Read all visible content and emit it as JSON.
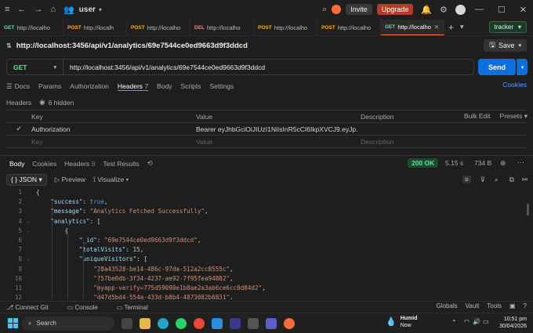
{
  "titlebar": {
    "workspace": "user",
    "invite": "Invite",
    "upgrade": "Upgrade"
  },
  "tabs": [
    {
      "method": "GET",
      "label": "http://localho"
    },
    {
      "method": "POST",
      "label": "http://localh"
    },
    {
      "method": "POST",
      "label": "http://localho"
    },
    {
      "method": "DEL",
      "label": "http://localho"
    },
    {
      "method": "POST",
      "label": "http://localho"
    },
    {
      "method": "POST",
      "label": "http://localho"
    },
    {
      "method": "GET",
      "label": "http://localho"
    }
  ],
  "environment": "tracker",
  "request": {
    "title": "http://localhost:3456/api/v1/analytics/69e7544ce0ed9663d9f3ddcd",
    "save": "Save",
    "method": "GET",
    "url": "http://localhost:3456/api/v1/analytics/69e7544ce0ed9663d9f3ddcd",
    "send": "Send",
    "tabs": [
      "Docs",
      "Params",
      "Authorization",
      "Headers",
      "Body",
      "Scripts",
      "Settings"
    ],
    "headers_count": "7",
    "cookies": "Cookies",
    "headers_label": "Headers",
    "hidden": "6 hidden"
  },
  "headers_table": {
    "columns": [
      "Key",
      "Value",
      "Description",
      "Bulk Edit",
      "Presets"
    ],
    "rows": [
      {
        "key": "Authorization",
        "value": "Bearer eyJhbGciOiJIUzI1NiIsInR5cCI6IkpXVCJ9.eyJp..."
      }
    ],
    "placeholder": {
      "key": "Key",
      "value": "Value",
      "description": "Description"
    }
  },
  "response": {
    "tabs": [
      "Body",
      "Cookies",
      "Headers",
      "Test Results"
    ],
    "headers_count": "8",
    "status": "200 OK",
    "time": "5.15 s",
    "size": "734 B",
    "format": "JSON",
    "preview": "Preview",
    "visualize": "Visualize"
  },
  "code_lines": [
    "{",
    "    \"success\": true,",
    "    \"message\": \"Analytics Fetched Successfully\",",
    "    \"analytics\": [",
    "        {",
    "            \"_id\": \"69e7544ce0ed9663d9f3ddcd\",",
    "            \"totalVisits\": 15,",
    "            \"uniqueVisitors\": [",
    "                \"28a43528-be14-486c-97da-512a2cc8555c\",",
    "                \"f57be0db-3f34-4237-ae92-7f95fea94882\",",
    "                \"myapp-verify=775d59090e1b8ae2a3ab6ce6cc0d84d2\",",
    "                \"d47d5bd4-554a-433d-b8b4-4873082b6831\","
  ],
  "footer": {
    "left": [
      "Connect Git",
      "Console",
      "Terminal"
    ],
    "right": [
      "Globals",
      "Vault",
      "Tools"
    ]
  },
  "taskbar": {
    "search": "Search",
    "weather_temp": "Humid",
    "weather_sub": "Now",
    "time": "10:51 pm",
    "date": "30/04/2026"
  }
}
